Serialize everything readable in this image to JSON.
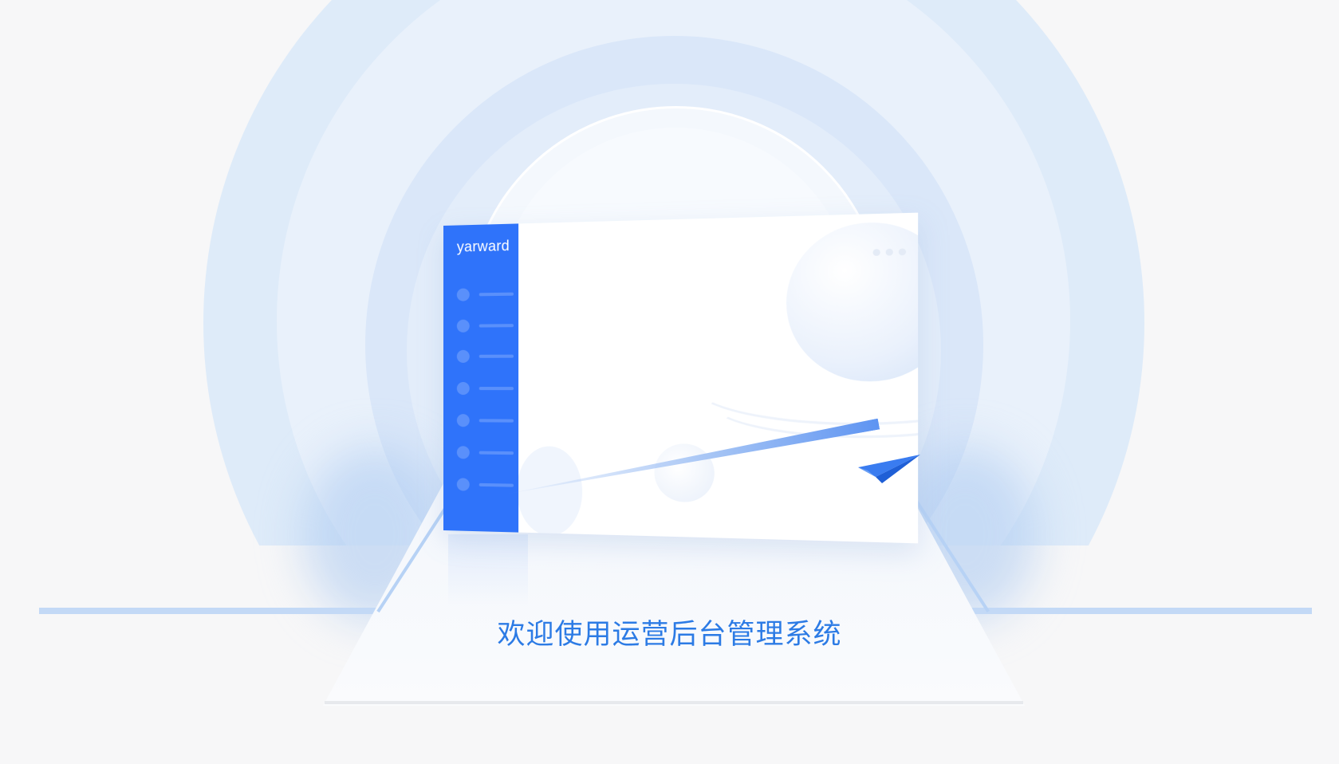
{
  "app_mockup": {
    "logo_text": "yarward",
    "nav_item_count": 7,
    "window_dot_count": 3
  },
  "welcome_text": "欢迎使用运营后台管理系统",
  "colors": {
    "accent": "#2f73fa",
    "welcome_text": "#2c7be5",
    "ring_light": "#e3edfa",
    "background": "#f7f7f8"
  },
  "icons": [
    "paper-plane-icon"
  ]
}
